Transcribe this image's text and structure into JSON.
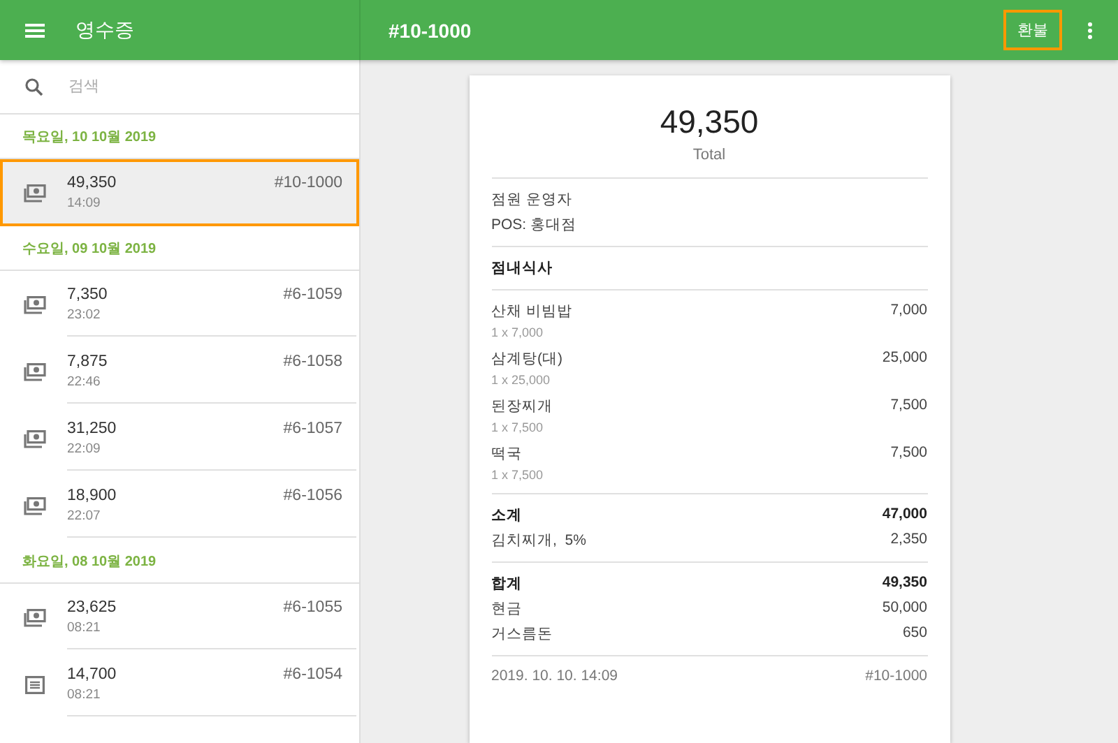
{
  "app_bar": {
    "title": "영수증",
    "receipt_title": "#10-1000",
    "refund_button": {
      "label": "환불",
      "highlighted": true
    }
  },
  "search": {
    "placeholder": "검색"
  },
  "groups": [
    {
      "date": "목요일, 10 10월 2019",
      "receipts": [
        {
          "kind": "cash",
          "amount": "49,350",
          "time": "14:09",
          "number": "#10-1000",
          "selected": true
        }
      ]
    },
    {
      "date": "수요일, 09 10월 2019",
      "receipts": [
        {
          "kind": "cash",
          "amount": "7,350",
          "time": "23:02",
          "number": "#6-1059",
          "selected": false
        },
        {
          "kind": "cash",
          "amount": "7,875",
          "time": "22:46",
          "number": "#6-1058",
          "selected": false
        },
        {
          "kind": "cash",
          "amount": "31,250",
          "time": "22:09",
          "number": "#6-1057",
          "selected": false
        },
        {
          "kind": "cash",
          "amount": "18,900",
          "time": "22:07",
          "number": "#6-1056",
          "selected": false
        }
      ]
    },
    {
      "date": "화요일, 08 10월 2019",
      "receipts": [
        {
          "kind": "cash",
          "amount": "23,625",
          "time": "08:21",
          "number": "#6-1055",
          "selected": false
        },
        {
          "kind": "list",
          "amount": "14,700",
          "time": "08:21",
          "number": "#6-1054",
          "selected": false
        }
      ]
    }
  ],
  "receipt": {
    "total": "49,350",
    "total_label": "Total",
    "cashier": "점원 운영자",
    "pos": "POS: 홍대점",
    "dining_option": "점내식사",
    "items": [
      {
        "name": "산채 비빔밥",
        "price": "7,000",
        "detail": "1 x 7,000"
      },
      {
        "name": "삼계탕(대)",
        "price": "25,000",
        "detail": "1 x 25,000"
      },
      {
        "name": "된장찌개",
        "price": "7,500",
        "detail": "1 x 7,500"
      },
      {
        "name": "떡국",
        "price": "7,500",
        "detail": "1 x 7,500"
      }
    ],
    "subtotal": {
      "label": "소계",
      "value": "47,000"
    },
    "tax": {
      "label": "김치찌개,  5%",
      "value": "2,350"
    },
    "grand_total": {
      "label": "합계",
      "value": "49,350"
    },
    "payments": [
      {
        "label": "현금",
        "value": "50,000"
      },
      {
        "label": "거스름돈",
        "value": "650"
      }
    ],
    "datetime": "2019. 10. 10. 14:09",
    "number": "#10-1000"
  }
}
